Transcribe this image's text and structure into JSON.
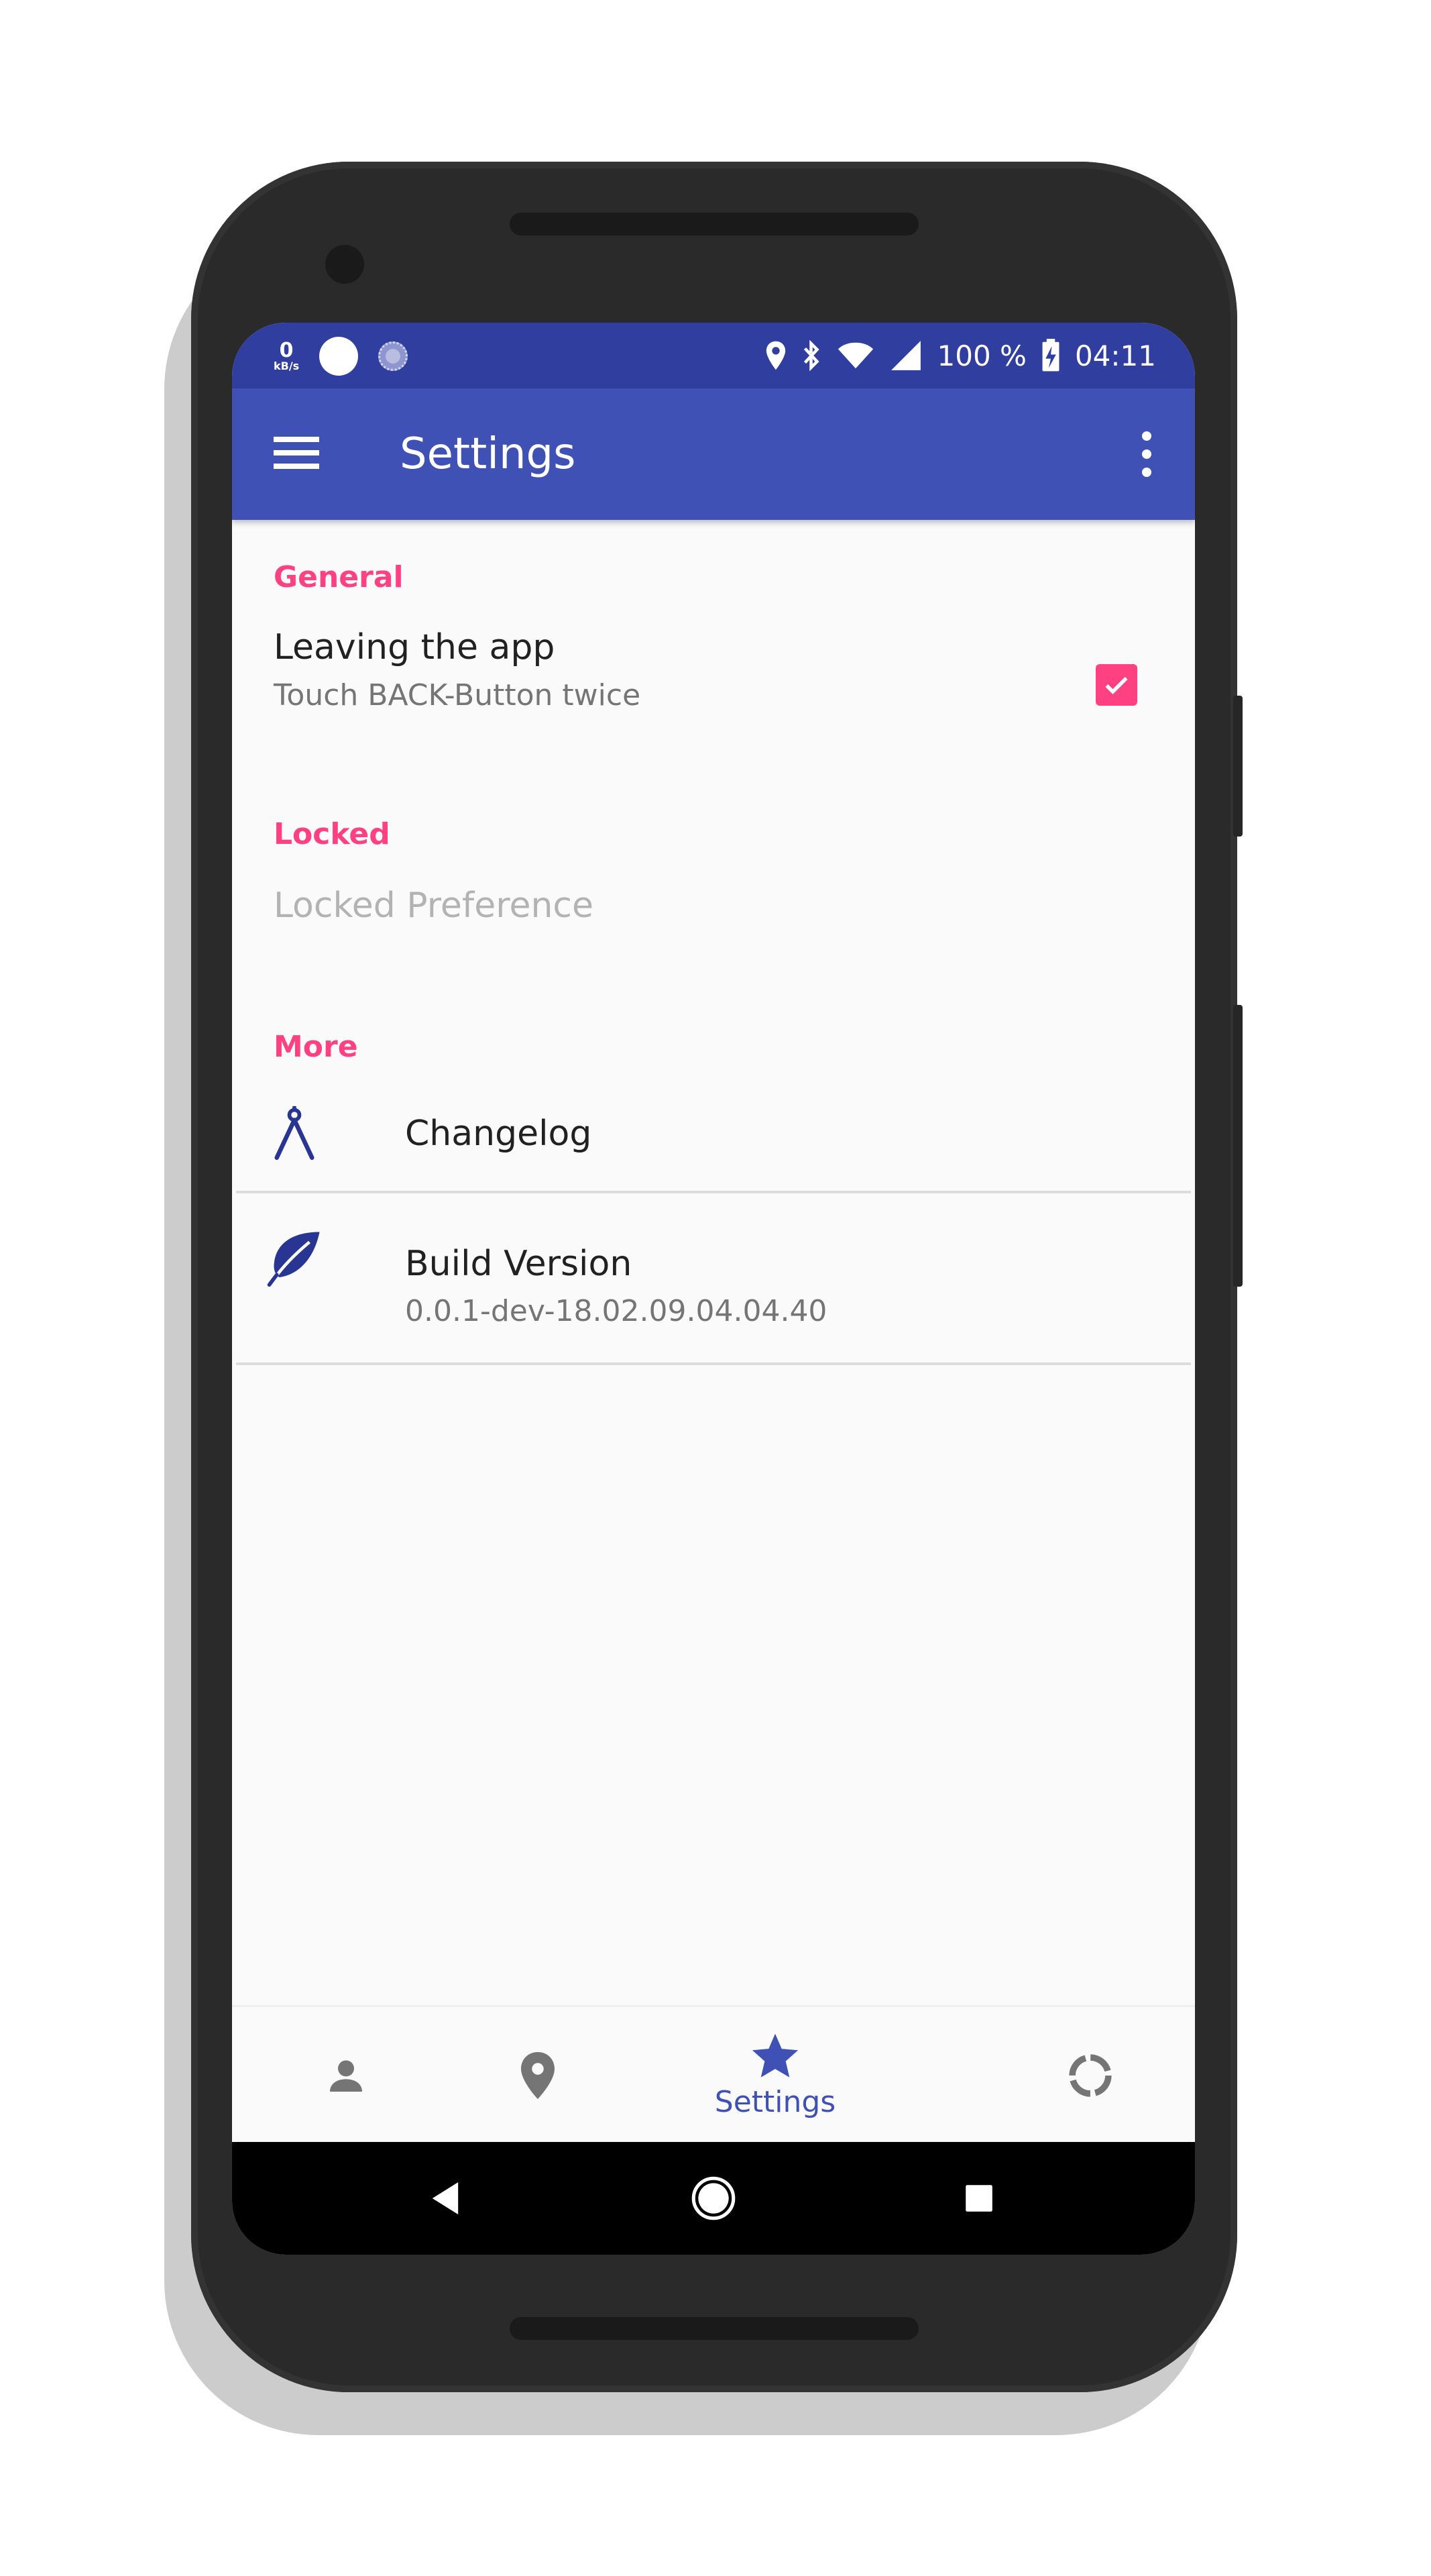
{
  "status_bar": {
    "net_speed_value": "0",
    "net_speed_unit": "kB/s",
    "battery_text": "100 %",
    "time": "04:11",
    "icons": [
      "location-icon",
      "bluetooth-icon",
      "wifi-icon",
      "cell-signal-icon",
      "battery-charging-icon"
    ]
  },
  "app_bar": {
    "title": "Settings",
    "menu_icon": "hamburger-menu-icon",
    "overflow_icon": "more-vert-icon"
  },
  "sections": {
    "general": {
      "header": "General",
      "leaving_title": "Leaving the app",
      "leaving_summary": "Touch BACK-Button twice",
      "leaving_checked": true
    },
    "locked": {
      "header": "Locked",
      "locked_title": "Locked Preference"
    },
    "more": {
      "header": "More",
      "changelog_title": "Changelog",
      "changelog_icon": "compass-icon",
      "build_title": "Build Version",
      "build_summary": "0.0.1-dev-18.02.09.04.04.40",
      "build_icon": "leaf-icon"
    }
  },
  "bottom_nav": {
    "items": [
      {
        "icon": "person-icon",
        "label": "",
        "active": false
      },
      {
        "icon": "place-icon",
        "label": "",
        "active": false
      },
      {
        "icon": "star-icon",
        "label": "Settings",
        "active": true
      },
      {
        "icon": "loading-ring-icon",
        "label": "",
        "active": false
      }
    ]
  },
  "system_nav": {
    "back": "back-icon",
    "home": "home-icon",
    "recents": "recents-icon"
  },
  "colors": {
    "primary": "#3f51b5",
    "primary_dark": "#303f9f",
    "accent": "#ff4081",
    "icon_blue": "#283593"
  }
}
